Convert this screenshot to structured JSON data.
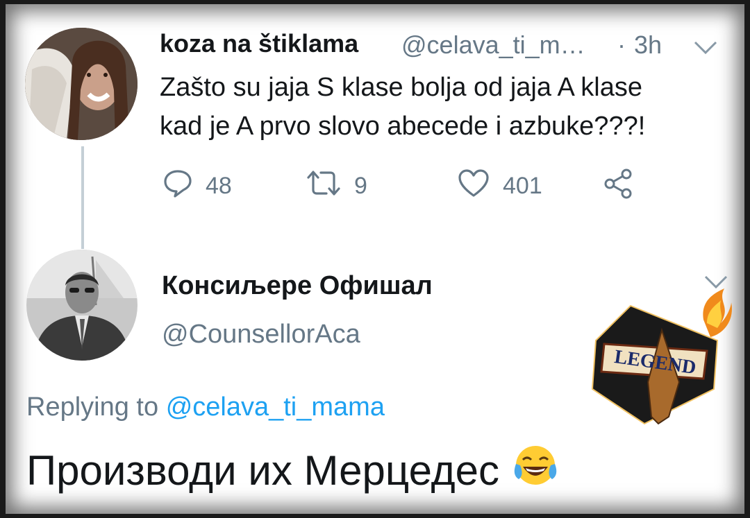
{
  "tweet": {
    "author_name": "koza na štiklama",
    "author_handle": "@celava_ti_m…",
    "separator": "·",
    "time": "3h",
    "text_line1": "Zašto su jaja S klase bolja od jaja A klase",
    "text_line2": "kad je A prvo slovo abecede i azbuke???!",
    "stats": {
      "replies": "48",
      "retweets": "9",
      "likes": "401"
    }
  },
  "reply": {
    "author_name": "Консиљере Офишал",
    "author_handle": "@CounsellorAca",
    "replying_prefix": "Replying to",
    "replying_mention": "@celava_ti_mama",
    "text": "Производи их Мерцедес"
  },
  "sticker": {
    "logo_text": "LEGEND"
  },
  "colors": {
    "text_primary": "#14171a",
    "text_secondary": "#657786",
    "link": "#1da1f2",
    "thread_line": "#c4cfd6"
  },
  "icons": [
    "chevron-down-icon",
    "reply-icon",
    "retweet-icon",
    "like-icon",
    "share-icon",
    "laughing-crying-emoji"
  ]
}
